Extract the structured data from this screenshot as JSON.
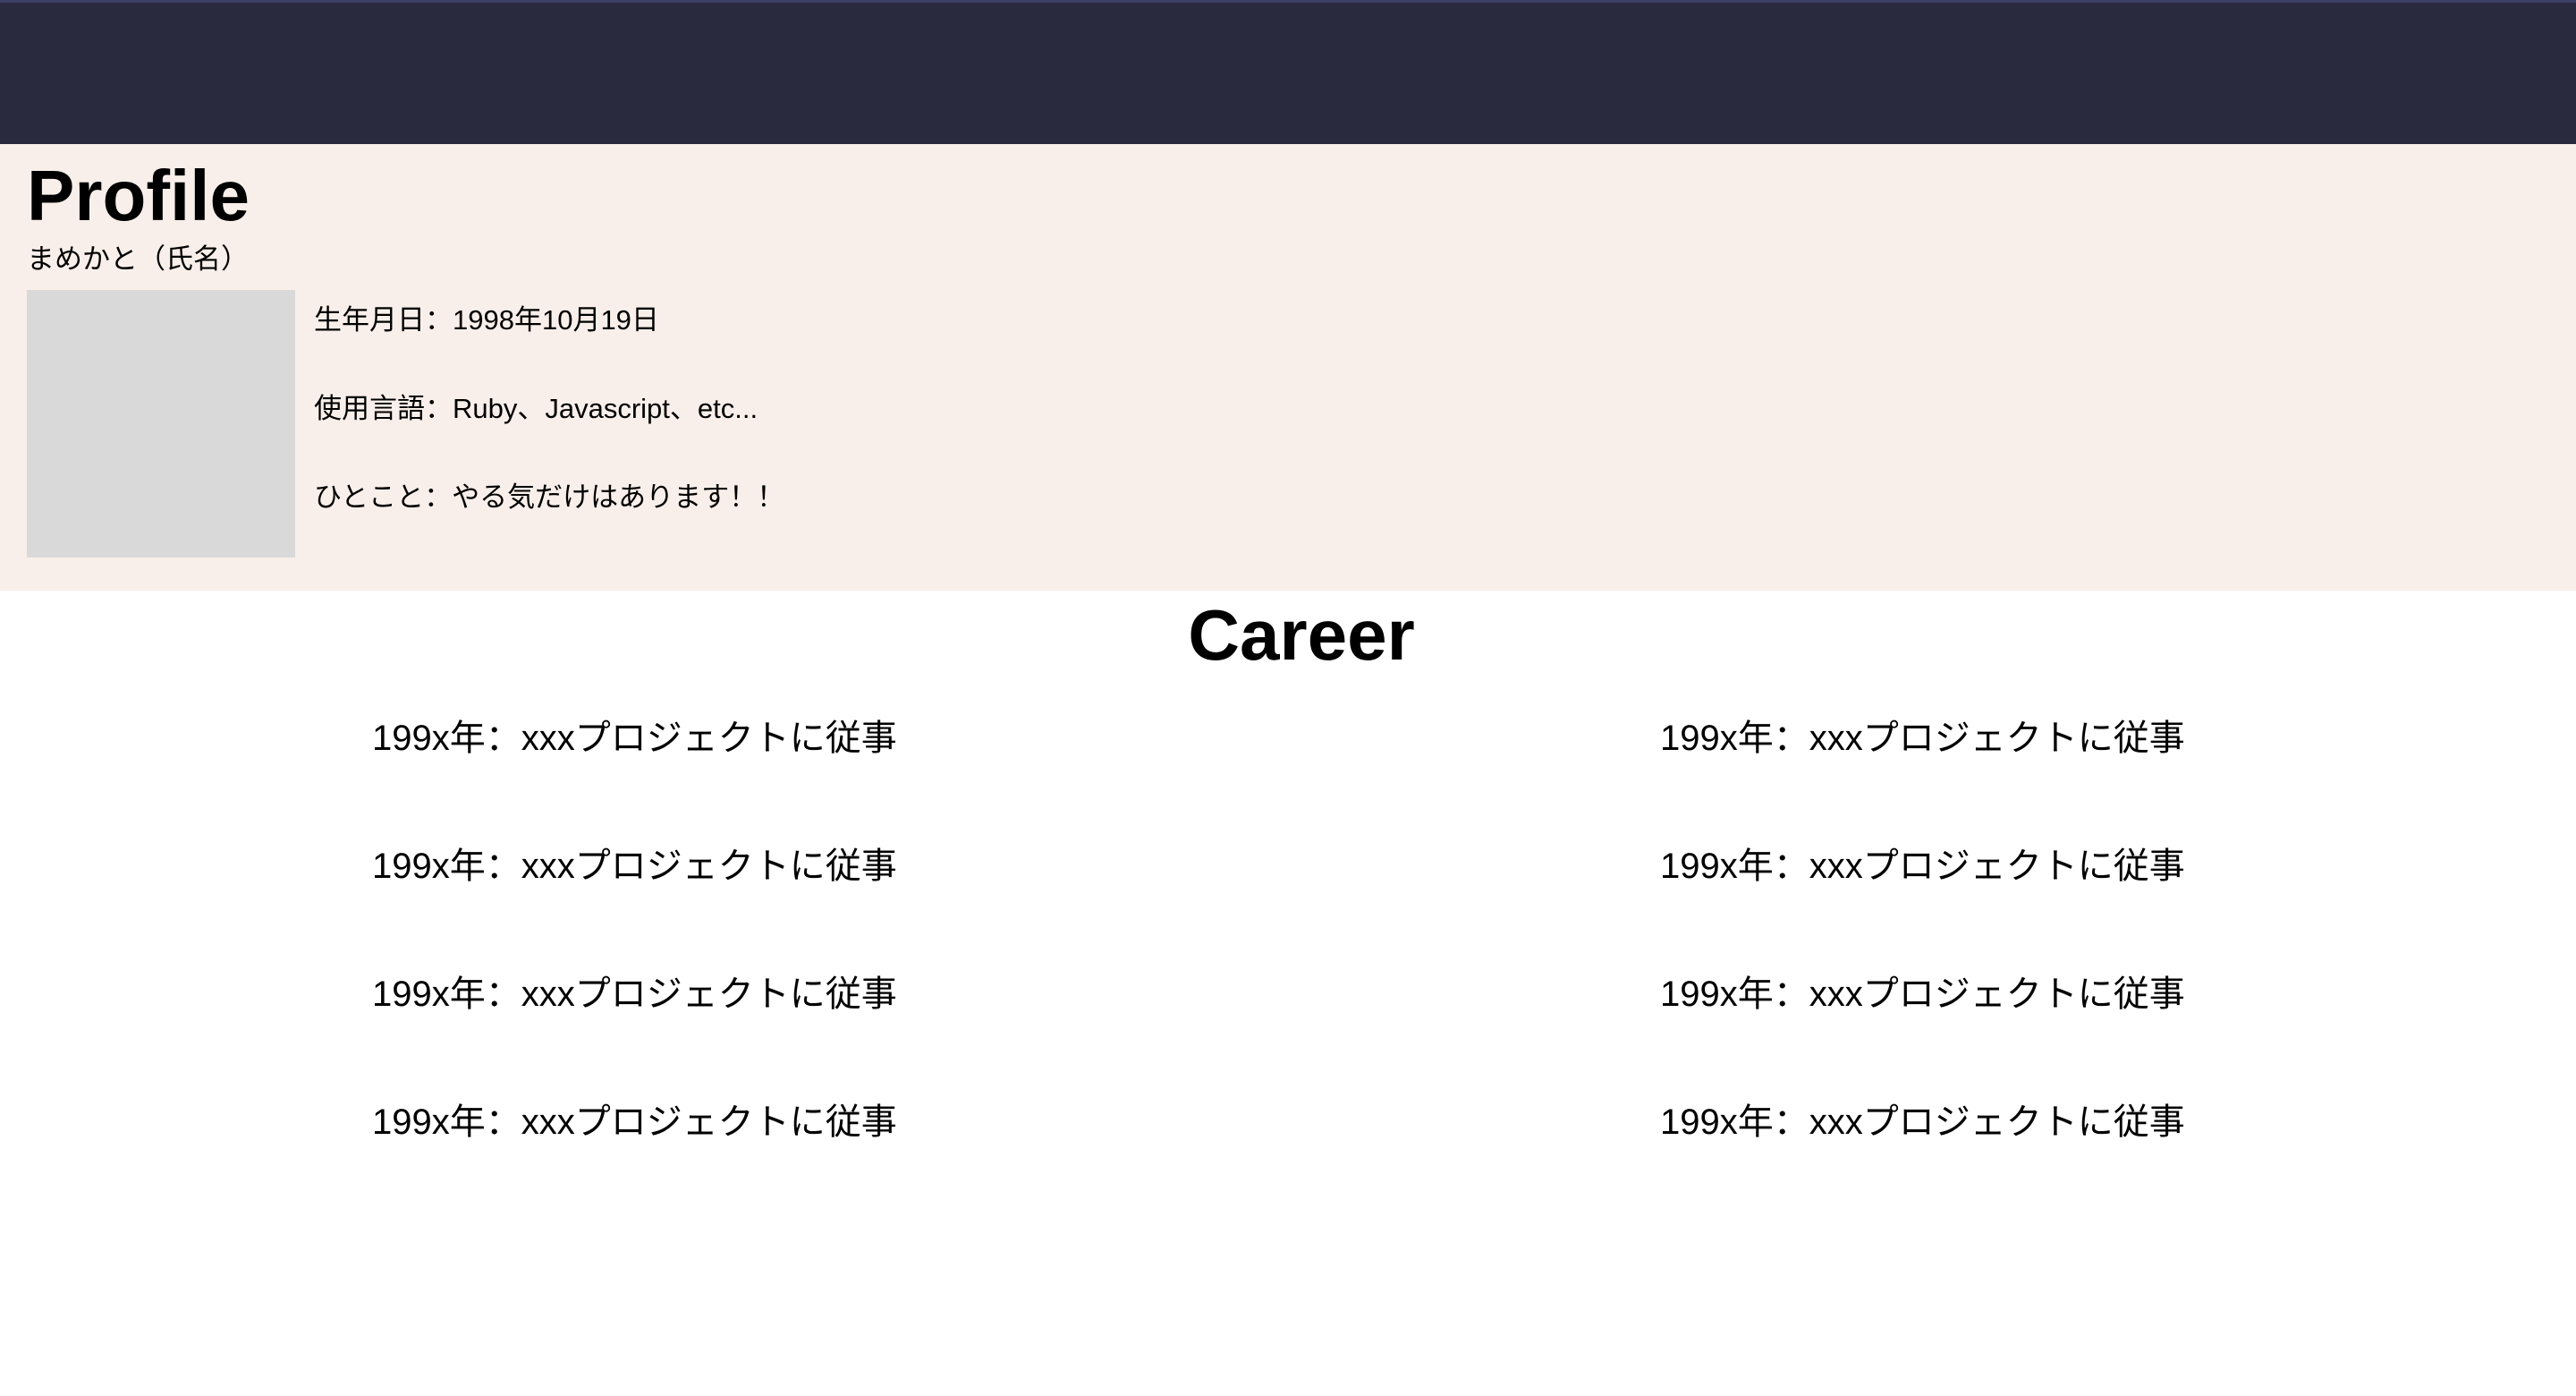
{
  "colors": {
    "topbar": "#292a3e",
    "profile_background": "#f9efea",
    "photo_placeholder": "#d9d9d9",
    "page_background": "#ffffff",
    "text": "#000000"
  },
  "profile": {
    "title": "Profile",
    "name": "まめかと（氏名）",
    "details": [
      "生年月日：1998年10月19日",
      "使用言語：Ruby、Javascript、etc...",
      "ひとこと：やる気だけはあります！！"
    ]
  },
  "career": {
    "title": "Career",
    "left_items": [
      "199x年：xxxプロジェクトに従事",
      "199x年：xxxプロジェクトに従事",
      "199x年：xxxプロジェクトに従事",
      "199x年：xxxプロジェクトに従事"
    ],
    "right_items": [
      "199x年：xxxプロジェクトに従事",
      "199x年：xxxプロジェクトに従事",
      "199x年：xxxプロジェクトに従事",
      "199x年：xxxプロジェクトに従事"
    ]
  }
}
